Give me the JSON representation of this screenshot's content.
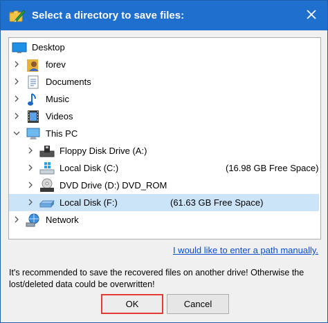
{
  "window": {
    "title": "Select a directory to save files:",
    "title_icon": "folder-pen-icon",
    "close_glyph": "✕"
  },
  "tree": {
    "items": [
      {
        "label": "Desktop",
        "icon": "desktop-icon",
        "expandable": false,
        "expanded": false,
        "indent": 0,
        "free": ""
      },
      {
        "label": "forev",
        "icon": "user-folder-icon",
        "expandable": true,
        "expanded": false,
        "indent": 0,
        "free": ""
      },
      {
        "label": "Documents",
        "icon": "documents-icon",
        "expandable": true,
        "expanded": false,
        "indent": 0,
        "free": ""
      },
      {
        "label": "Music",
        "icon": "music-icon",
        "expandable": true,
        "expanded": false,
        "indent": 0,
        "free": ""
      },
      {
        "label": "Videos",
        "icon": "videos-icon",
        "expandable": true,
        "expanded": false,
        "indent": 0,
        "free": ""
      },
      {
        "label": "This PC",
        "icon": "computer-icon",
        "expandable": true,
        "expanded": true,
        "indent": 0,
        "free": ""
      },
      {
        "label": "Floppy Disk Drive (A:)",
        "icon": "floppy-drive-icon",
        "expandable": true,
        "expanded": false,
        "indent": 1,
        "free": ""
      },
      {
        "label": "Local Disk (C:)",
        "icon": "windows-drive-icon",
        "expandable": true,
        "expanded": false,
        "indent": 1,
        "free": "(16.98 GB Free Space)"
      },
      {
        "label": "DVD Drive (D:) DVD_ROM",
        "icon": "dvd-drive-icon",
        "expandable": true,
        "expanded": false,
        "indent": 1,
        "free": ""
      },
      {
        "label": "Local Disk (F:)",
        "icon": "hard-drive-icon",
        "expandable": true,
        "expanded": false,
        "indent": 1,
        "free": "(61.63 GB Free Space)",
        "selected": true
      },
      {
        "label": "Network",
        "icon": "network-icon",
        "expandable": true,
        "expanded": false,
        "indent": 0,
        "free": ""
      }
    ]
  },
  "manual_path_link": "I would like to enter a path manually.",
  "note": "It's recommended to save the recovered files on another drive! Otherwise the lost/deleted data could be overwritten!",
  "buttons": {
    "ok": "OK",
    "cancel": "Cancel"
  },
  "colors": {
    "titlebar": "#1f6fce",
    "selection": "#cce4f7",
    "link": "#0b4cd1",
    "ok_highlight": "#e53935"
  }
}
